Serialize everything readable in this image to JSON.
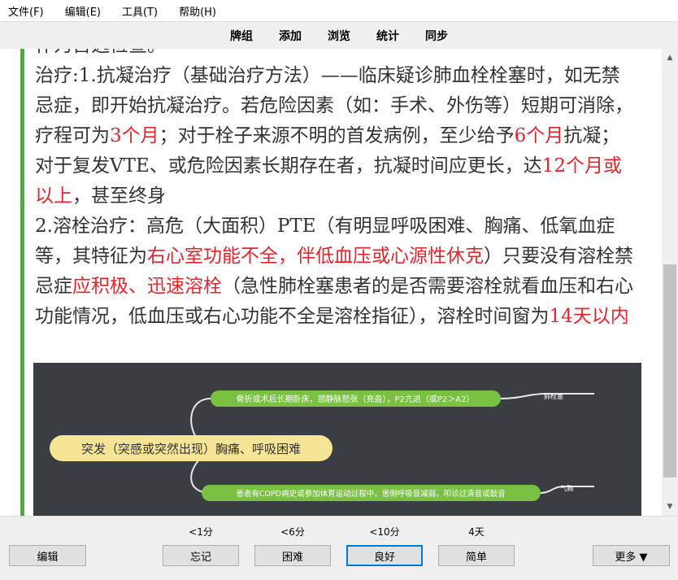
{
  "menubar": {
    "items": [
      "文件(F)",
      "编辑(E)",
      "工具(T)",
      "帮助(H)"
    ]
  },
  "toolbar": {
    "items": [
      "牌组",
      "添加",
      "浏览",
      "统计",
      "同步"
    ]
  },
  "card": {
    "top_line": "作为首选检查。",
    "p1_a": "治疗:1.抗凝治疗（基础治疗方法）——临床疑诊肺血栓栓塞时，如无禁忌症，即开始抗凝治疗。若危险因素（如：手术、外伤等）短期可消除，疗程可为",
    "p1_r1": "3个月",
    "p1_b": "；对于栓子来源不明的首发病例，至少给予",
    "p1_r2": "6个月",
    "p1_c": "抗凝；对于复发VTE、或危险因素长期存在者，抗凝时间应更长，达",
    "p1_r3": "12个月或以上",
    "p1_d": "，甚至终身",
    "p2_a": "2.溶栓治疗：高危（大面积）PTE（有明显呼吸困难、胸痛、低氧血症等，其特征为",
    "p2_r1": "右心室功能不全，伴低血压或心源性休克",
    "p2_b": "）只要没有溶栓禁忌症",
    "p2_r2": "应积极、迅速溶栓",
    "p2_c": "（急性肺栓塞患者的是否需要溶栓就看血压和右心功能情况，低血压或右心功能不全是溶栓指征），溶栓时间窗为",
    "p2_r3": "14天以内"
  },
  "mindmap": {
    "central": "突发（突感或突然出现）胸痛、呼吸困难",
    "branch_top": "骨折或术后长期卧床，颈静脉怒张（充盈），P2亢进（或P2＞A2）",
    "branch_top_leaf": "肺栓塞",
    "branch_bottom": "患者有COPD病史或参加体育运动过程中，患侧呼吸音减弱，叩诊过清音或鼓音",
    "branch_bottom_leaf": "气胸"
  },
  "review": {
    "edit_label": "编辑",
    "more_label": "更多 ▼",
    "intervals": [
      "<1分",
      "<6分",
      "<10分",
      "4天"
    ],
    "answers": [
      "忘记",
      "困难",
      "良好",
      "简单"
    ]
  },
  "colors": {
    "accent_green": "#4caf35",
    "highlight_red": "#e8232a",
    "mindmap_bg": "#3a3d41",
    "mindmap_branch": "#7ac143",
    "mindmap_central": "#f7e597"
  }
}
